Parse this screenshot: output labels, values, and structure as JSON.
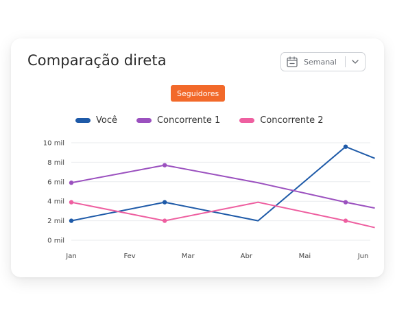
{
  "card": {
    "title": "Comparação direta",
    "period": {
      "label": "Semanal",
      "icon": "calendar-icon",
      "chevron": "chevron-down-icon"
    },
    "metric_badge": {
      "label": "Seguidores",
      "color": "#f2692a"
    }
  },
  "chart_data": {
    "type": "line",
    "x": [
      "Jan",
      "Fev",
      "Mar",
      "Abr",
      "Mai",
      "Jun"
    ],
    "y_ticks": [
      "0 mil",
      "2 mil",
      "4 mil",
      "6 mil",
      "8 mil",
      "10 mil"
    ],
    "ylim": [
      0,
      10
    ],
    "grid": true,
    "legend_position": "top",
    "series": [
      {
        "name": "Você",
        "color": "#1e5aa8",
        "points": [
          [
            1,
            2
          ],
          [
            2.6,
            3.9
          ],
          [
            4.2,
            2
          ],
          [
            5.7,
            9.6
          ],
          [
            6.2,
            8.4
          ]
        ],
        "markers": [
          [
            1,
            2
          ],
          [
            2.6,
            3.9
          ],
          [
            5.7,
            9.6
          ]
        ]
      },
      {
        "name": "Concorrente 1",
        "color": "#9b51bf",
        "points": [
          [
            1,
            5.9
          ],
          [
            2.6,
            7.7
          ],
          [
            4.2,
            5.9
          ],
          [
            5.7,
            3.9
          ],
          [
            6.2,
            3.3
          ]
        ],
        "markers": [
          [
            1,
            5.9
          ],
          [
            2.6,
            7.7
          ],
          [
            5.7,
            3.9
          ]
        ]
      },
      {
        "name": "Concorrente 2",
        "color": "#ee5fa0",
        "points": [
          [
            1,
            3.9
          ],
          [
            2.6,
            2
          ],
          [
            4.2,
            3.9
          ],
          [
            5.7,
            2
          ],
          [
            6.2,
            1.3
          ]
        ],
        "markers": [
          [
            1,
            3.9
          ],
          [
            2.6,
            2
          ],
          [
            5.7,
            2
          ]
        ]
      }
    ]
  }
}
